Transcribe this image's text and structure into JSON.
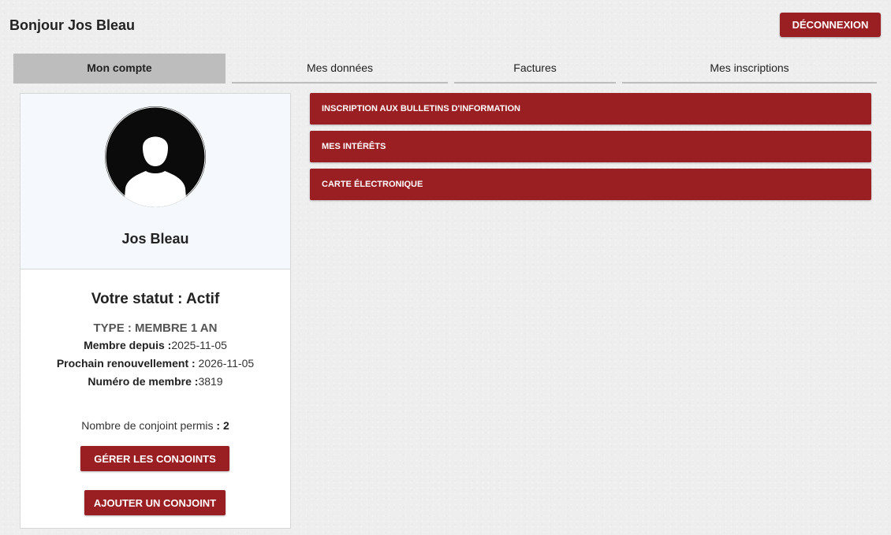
{
  "header": {
    "greeting": "Bonjour Jos Bleau",
    "logout_label": "DÉCONNEXION"
  },
  "tabs": [
    {
      "label": "Mon compte",
      "active": true
    },
    {
      "label": "Mes données",
      "active": false
    },
    {
      "label": "Factures",
      "active": false
    },
    {
      "label": "Mes inscriptions",
      "active": false
    }
  ],
  "profile": {
    "avatar_icon": "user-silhouette-icon",
    "name": "Jos Bleau",
    "status_title": "Votre statut : Actif",
    "type": "TYPE : MEMBRE 1 AN",
    "member_since_label": "Membre depuis :",
    "member_since_value": "2025-11-05",
    "renewal_label": "Prochain renouvellement :",
    "renewal_value": " 2026-11-05",
    "member_number_label": "Numéro de membre :",
    "member_number_value": "3819",
    "spouse_count_label": "Nombre de conjoint permis ",
    "spouse_count_value": ": 2",
    "manage_spouses_label": "GÉRER LES CONJOINTS",
    "add_spouse_label": "AJOUTER UN CONJOINT"
  },
  "accordion": [
    {
      "label": "INSCRIPTION AUX BULLETINS D'INFORMATION"
    },
    {
      "label": "MES INTÉRÊTS"
    },
    {
      "label": "CARTE ÉLECTRONIQUE"
    }
  ],
  "colors": {
    "accent": "#9a1f23",
    "active_tab": "#bdbdbd",
    "background": "#eeeeee"
  }
}
